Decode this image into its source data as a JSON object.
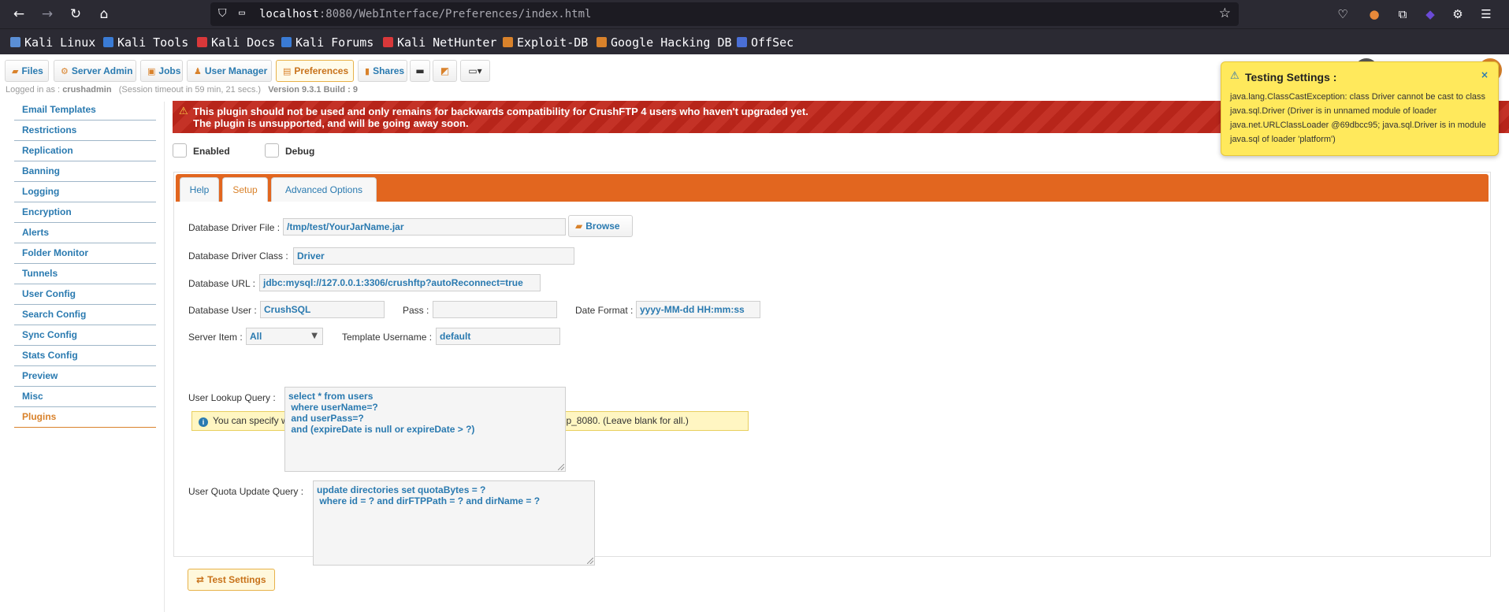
{
  "browser": {
    "url_host": "localhost",
    "url_rest": ":8080/WebInterface/Preferences/index.html",
    "bookmarks": [
      {
        "label": "Kali Linux",
        "color": "#5b8fd6"
      },
      {
        "label": "Kali Tools",
        "color": "#3a7bd5"
      },
      {
        "label": "Kali Docs",
        "color": "#d9383a"
      },
      {
        "label": "Kali Forums",
        "color": "#3a7bd5"
      },
      {
        "label": "Kali NetHunter",
        "color": "#d9383a"
      },
      {
        "label": "Exploit-DB",
        "color": "#d9822b"
      },
      {
        "label": "Google Hacking DB",
        "color": "#d9822b"
      },
      {
        "label": "OffSec",
        "color": "#4a6fd6"
      }
    ]
  },
  "topnav": {
    "files": "Files",
    "server_admin": "Server Admin",
    "jobs": "Jobs",
    "user_manager": "User Manager",
    "preferences": "Preferences",
    "shares": "Shares"
  },
  "session": {
    "logged_in_prefix": "Logged in as :",
    "user": "crushadmin",
    "timeout": "(Session timeout in 59 min, 21 secs.)",
    "version": "Version 9.3.1 Build : 9"
  },
  "leftmenu": [
    "Email Templates",
    "Restrictions",
    "Replication",
    "Banning",
    "Logging",
    "Encryption",
    "Alerts",
    "Folder Monitor",
    "Tunnels",
    "User Config",
    "Search Config",
    "Sync Config",
    "Stats Config",
    "Preview",
    "Misc",
    "Plugins"
  ],
  "warning": {
    "line1": "This plugin should not be used and only remains for backwards compatibility for CrushFTP 4 users who haven't upgraded yet.",
    "line2": "The plugin is unsupported, and will be going away soon."
  },
  "checks": {
    "enabled": "Enabled",
    "debug": "Debug"
  },
  "tabs": [
    "Help",
    "Setup",
    "Advanced Options"
  ],
  "form": {
    "driver_file_label": "Database Driver File :",
    "driver_file_value": "/tmp/test/YourJarName.jar",
    "browse": "Browse",
    "driver_class_label": "Database Driver Class :",
    "driver_class_value": "Driver",
    "url_label": "Database URL :",
    "url_value": "jdbc:mysql://127.0.0.1:3306/crushftp?autoReconnect=true",
    "user_label": "Database User :",
    "user_value": "CrushSQL",
    "pass_label": "Pass :",
    "pass_value": "",
    "date_label": "Date Format :",
    "date_value": "yyyy-MM-dd HH:mm:ss",
    "server_item_label": "Server Item :",
    "server_item_value": "All",
    "template_label": "Template Username :",
    "template_value": "default",
    "info": "You can specify which server item will use this plugin. Example : lookup_21, or lookup_8080. (Leave blank for all.)",
    "lookup_label": "User Lookup Query :",
    "lookup_value": "select * from users\n where userName=?\n and userPass=?\n and (expireDate is null or expireDate > ?)",
    "quota_label": "User Quota Update Query :",
    "quota_value": "update directories set quotaBytes = ?\n where id = ? and dirFTPPath = ? and dirName = ?",
    "test_button": "Test Settings"
  },
  "notification": {
    "title": "Testing Settings :",
    "close": "×",
    "body": "java.lang.ClassCastException: class Driver cannot be cast to class java.sql.Driver (Driver is in unnamed module of loader java.net.URLClassLoader @69dbcc95; java.sql.Driver is in module java.sql of loader 'platform')"
  }
}
